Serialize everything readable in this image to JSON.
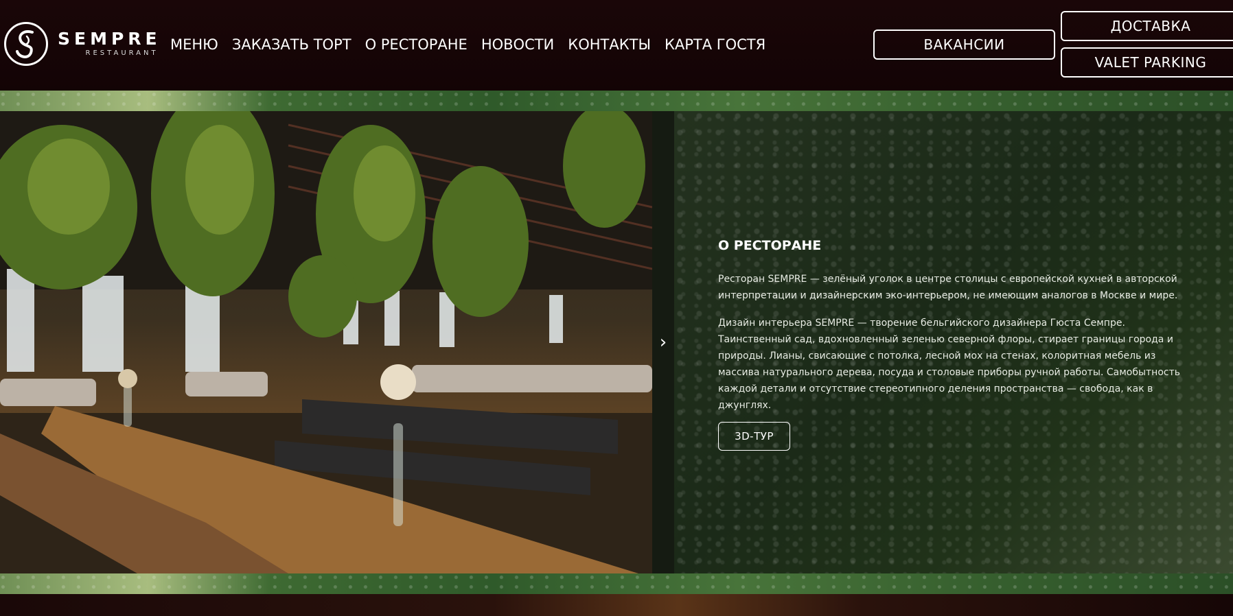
{
  "brand": {
    "name": "SEMPRE",
    "subtitle": "RESTAURANT"
  },
  "nav": {
    "items": [
      {
        "label": "МЕНЮ"
      },
      {
        "label": "ЗАКАЗАТЬ ТОРТ"
      },
      {
        "label": "О РЕСТОРАНЕ"
      },
      {
        "label": "НОВОСТИ"
      },
      {
        "label": "КОНТАКТЫ"
      },
      {
        "label": "КАРТА ГОСТЯ"
      }
    ]
  },
  "header_buttons": {
    "vacancies": "ВАКАНСИИ",
    "delivery": "ДОСТАВКА",
    "valet": "VALET PARKING"
  },
  "about": {
    "title": "О РЕСТОРАНЕ",
    "paragraph1": "Ресторан SEMPRE — зелёный уголок в центре столицы с европейской кухней в авторской интерпретации и дизайнерским эко-интерьером, не имеющим аналогов в Москве и мире.",
    "paragraph2": "Дизайн интерьера SEMPRE — творение бельгийского дизайнера Гюста Семпре. Таинственный сад, вдохновленный зеленью северной флоры, стирает границы города и природы. Лианы, свисающие с потолка, лесной мох на стенах, колоритная мебель из массива натурального дерева, посуда и столовые приборы ручной работы. Самобытность каждой детали и отсутствие стереотипного деления пространства — свобода, как в джунглях.",
    "tour_button": "3D-ТУР"
  },
  "slider": {
    "next_icon": "chevron-right-icon"
  },
  "colors": {
    "header_bg": "#130405",
    "accent_green": "#2f5a2a",
    "text": "#ffffff"
  }
}
